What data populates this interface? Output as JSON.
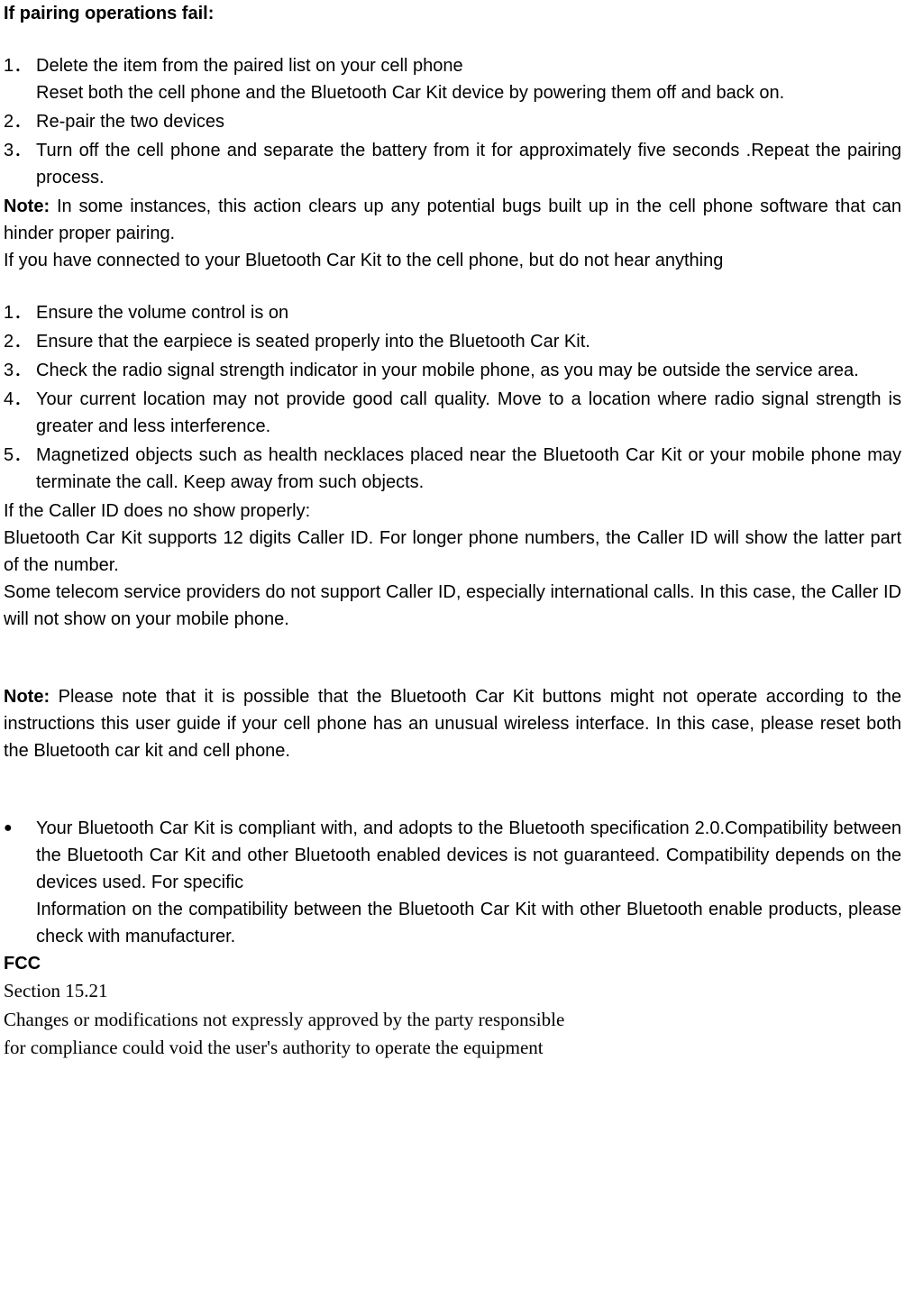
{
  "heading1": "If pairing operations fail:",
  "list1": [
    {
      "text": "Delete the item from the paired list on your cell phone",
      "sub": "Reset both the cell phone and the Bluetooth Car Kit device by powering them off and back on."
    },
    {
      "text": "Re-pair the two devices"
    },
    {
      "text": "Turn off the cell phone and separate the battery from it for approximately five seconds .Repeat the pairing process."
    }
  ],
  "note1_label": "Note:",
  "note1_text": " In some instances, this action clears up any potential bugs built up in the cell phone software that can hinder proper pairing.",
  "para1": "If you have connected to your Bluetooth Car Kit to the cell phone, but do not hear anything",
  "list2": [
    {
      "text": "Ensure the volume control is on"
    },
    {
      "text": "Ensure that the earpiece is seated properly into the Bluetooth Car Kit."
    },
    {
      "text": "Check the radio signal strength indicator in your mobile phone, as you may be outside the service area."
    },
    {
      "text": "Your current location may not provide good call quality. Move to a location where radio signal strength is greater and less interference."
    },
    {
      "text": "Magnetized objects such as health necklaces placed near the Bluetooth Car Kit or your mobile phone may terminate the call. Keep away from such objects."
    }
  ],
  "callerid_title": "If the Caller ID does no show properly:",
  "callerid_p1": "Bluetooth Car Kit supports 12 digits Caller ID. For longer phone numbers, the Caller ID will show the latter part of the number.",
  "callerid_p2": "Some telecom service providers do not support Caller ID, especially international calls. In this case, the Caller ID will not show on your mobile phone.",
  "note2_label": "Note:",
  "note2_text": " Please note that it is possible that the Bluetooth Car Kit buttons might not operate according to the instructions this user guide if your cell phone has an unusual wireless interface. In this case, please reset both the Bluetooth car kit and cell phone.",
  "bullet1_a": "Your Bluetooth Car Kit is compliant with, and adopts to the Bluetooth specification 2.0.Compatibility between the Bluetooth Car Kit and other Bluetooth enabled devices is not guaranteed. Compatibility depends on the devices used. For specific",
  "bullet1_b": "Information on the compatibility between the Bluetooth Car Kit with other Bluetooth enable products, please check with manufacturer.",
  "fcc_title": "FCC",
  "fcc_section": "Section 15.21",
  "fcc_l1": "Changes or modifications not expressly approved by the party responsible",
  "fcc_l2": "for compliance could void the user's authority to operate the equipment"
}
